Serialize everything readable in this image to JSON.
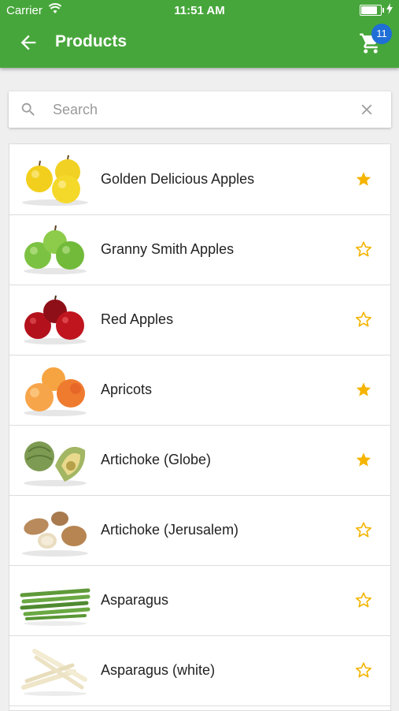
{
  "status_bar": {
    "carrier": "Carrier",
    "time": "11:51 AM"
  },
  "header": {
    "title": "Products",
    "cart_count": "11",
    "back_icon": "arrow-left-icon",
    "cart_icon": "shopping-cart-icon"
  },
  "search": {
    "placeholder": "Search",
    "value": ""
  },
  "colors": {
    "app_bar": "#47a63b",
    "badge": "#1f6fd6",
    "star": "#f5b400"
  },
  "products": [
    {
      "name": "Golden Delicious Apples",
      "favorite": true
    },
    {
      "name": "Granny Smith Apples",
      "favorite": false
    },
    {
      "name": "Red Apples",
      "favorite": false
    },
    {
      "name": "Apricots",
      "favorite": true
    },
    {
      "name": "Artichoke (Globe)",
      "favorite": true
    },
    {
      "name": "Artichoke (Jerusalem)",
      "favorite": false
    },
    {
      "name": "Asparagus",
      "favorite": false
    },
    {
      "name": "Asparagus (white)",
      "favorite": false
    }
  ]
}
